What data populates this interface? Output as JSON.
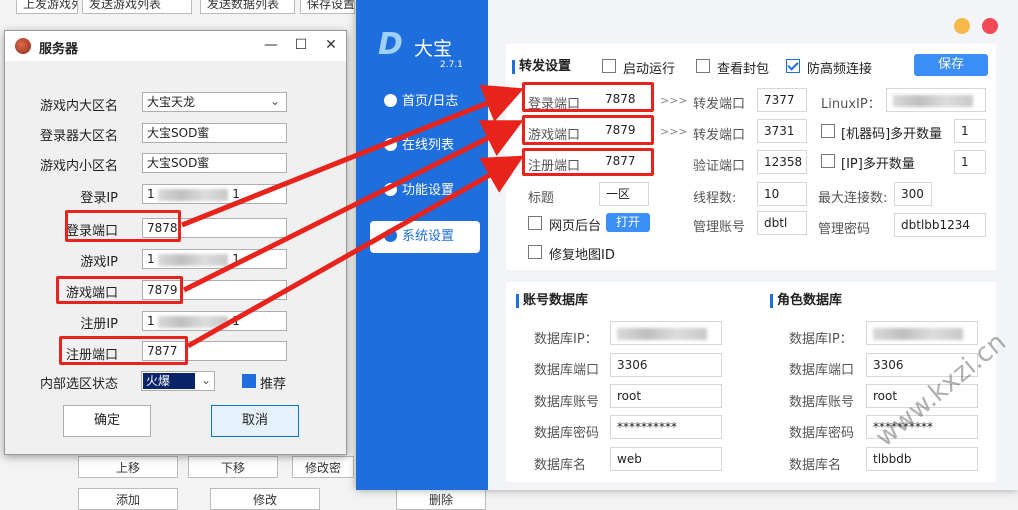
{
  "background_window": {
    "top_buttons": [
      "上发游戏列表",
      "发送游戏列表",
      "发送数据列表",
      "保存设置"
    ],
    "bottom_buttons": [
      "上移",
      "下移",
      "修改密",
      "添加",
      "修改",
      "删除"
    ]
  },
  "dialog": {
    "title": "服务器",
    "minimize": "—",
    "maximize": "☐",
    "close": "✕",
    "fields": [
      {
        "label": "游戏内大区名",
        "value": "大宝天龙",
        "type": "select"
      },
      {
        "label": "登录器大区名",
        "value": "大宝SOD蜜",
        "type": "text"
      },
      {
        "label": "游戏内小区名",
        "value": "大宝SOD蜜",
        "type": "text"
      },
      {
        "label": "登录IP",
        "value_prefix": "1",
        "value_suffix": "1",
        "type": "masked"
      },
      {
        "label": "登录端口",
        "value": "7878",
        "type": "text"
      },
      {
        "label": "游戏IP",
        "value_prefix": "1",
        "value_suffix": "1",
        "type": "masked"
      },
      {
        "label": "游戏端口",
        "value": "7879",
        "type": "text"
      },
      {
        "label": "注册IP",
        "value_prefix": "1",
        "value_suffix": "1",
        "type": "masked"
      },
      {
        "label": "注册端口",
        "value": "7877",
        "type": "text"
      }
    ],
    "state_label": "内部选区状态",
    "state_value": "火爆",
    "recommend_label": "推荐",
    "ok": "确定",
    "cancel": "取消"
  },
  "app": {
    "brand": "大宝",
    "version": "2.7.1",
    "nav": [
      "首页/日志",
      "在线列表",
      "功能设置",
      "系统设置"
    ],
    "forward": {
      "title": "转发设置",
      "autostart": "启动运行",
      "view_ban": "查看封包",
      "anti_freq": "防高频连接",
      "save": "保存",
      "login_port_label": "登录端口",
      "login_port": "7878",
      "game_port_label": "游戏端口",
      "game_port": "7879",
      "reg_port_label": "注册端口",
      "reg_port": "7877",
      "arrows": ">>>",
      "fwd_port_label": "转发端口",
      "fwd_port1": "7377",
      "fwd_port2": "3731",
      "verify_port_label": "验证端口",
      "verify_port": "12358",
      "linux_ip_label": "LinuxIP：",
      "machine_label": "[机器码]多开数量",
      "machine_count": "1",
      "ip_label": "[IP]多开数量",
      "ip_count": "1",
      "title_label": "标题",
      "title_value": "一区",
      "threads_label": "线程数:",
      "threads": "10",
      "maxconn_label": "最大连接数:",
      "maxconn": "300",
      "web_label": "网页后台",
      "open": "打开",
      "admin_label": "管理账号",
      "admin": "dbtl",
      "admin_pwd_label": "管理密码",
      "admin_pwd": "dbtlbb1234",
      "fix_map": "修复地图ID"
    },
    "account_db": {
      "title": "账号数据库",
      "ip_label": "数据库IP：",
      "port_label": "数据库端口",
      "port": "3306",
      "user_label": "数据库账号",
      "user": "root",
      "pwd_label": "数据库密码",
      "pwd": "**********",
      "name_label": "数据库名",
      "name": "web"
    },
    "role_db": {
      "title": "角色数据库",
      "ip_label": "数据库IP：",
      "port_label": "数据库端口",
      "port": "3306",
      "user_label": "数据库账号",
      "user": "root",
      "pwd_label": "数据库密码",
      "pwd": "**********",
      "name_label": "数据库名",
      "name": "tlbbdb"
    }
  },
  "watermark": "www.kxzi.cn",
  "colors": {
    "sidebar": "#1f6ede",
    "highlight": "#e8231b",
    "accent": "#3a8ef5"
  }
}
